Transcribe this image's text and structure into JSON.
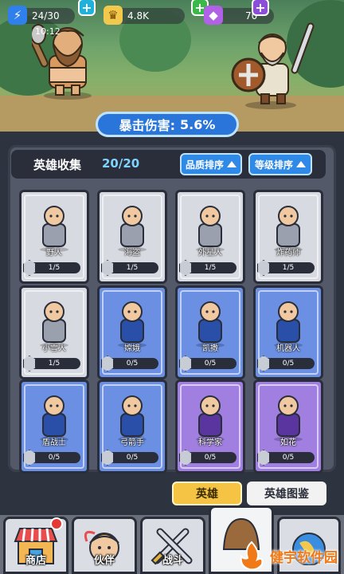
{
  "status": {
    "energy": "24/30",
    "timer": "10:12",
    "gold": "4.8K",
    "gems": "70",
    "colors": {
      "energy": "#2f80ed",
      "gold": "#f2c94c",
      "gem": "#b061e6",
      "plus": "#8a4ed8"
    }
  },
  "crit": {
    "label": "暴击伤害:",
    "value": "5.6%"
  },
  "collection": {
    "title": "英雄收集",
    "count": "20/20",
    "sort_quality": "品质排序",
    "sort_level": "等级排序"
  },
  "heroes": [
    {
      "name": "野人",
      "progress": "1/5",
      "rarity": "gray",
      "icon": "caveman-icon"
    },
    {
      "name": "海盗",
      "progress": "1/5",
      "rarity": "gray",
      "icon": "pirate-icon"
    },
    {
      "name": "外星人",
      "progress": "1/5",
      "rarity": "gray",
      "icon": "alien-icon"
    },
    {
      "name": "炸药师",
      "progress": "1/5",
      "rarity": "gray",
      "icon": "bomber-icon"
    },
    {
      "name": "小雪人",
      "progress": "1/5",
      "rarity": "gray",
      "icon": "snowman-icon"
    },
    {
      "name": "嫦娥",
      "progress": "0/5",
      "rarity": "blue",
      "icon": "change-icon"
    },
    {
      "name": "凯撒",
      "progress": "0/5",
      "rarity": "blue",
      "icon": "caesar-icon"
    },
    {
      "name": "机器人",
      "progress": "0/5",
      "rarity": "blue",
      "icon": "robot-icon"
    },
    {
      "name": "盾战士",
      "progress": "0/5",
      "rarity": "blue",
      "icon": "shield-warrior-icon"
    },
    {
      "name": "弓箭手",
      "progress": "0/5",
      "rarity": "blue",
      "icon": "archer-icon"
    },
    {
      "name": "科学家",
      "progress": "0/5",
      "rarity": "purple",
      "icon": "scientist-icon"
    },
    {
      "name": "如花",
      "progress": "0/5",
      "rarity": "purple",
      "icon": "ruhua-icon"
    }
  ],
  "tabs": {
    "heroes": "英雄",
    "atlas": "英雄图鉴"
  },
  "nav": {
    "shop": "商店",
    "partner": "伙伴",
    "battle": "战斗"
  },
  "watermark": "健宇软件园"
}
